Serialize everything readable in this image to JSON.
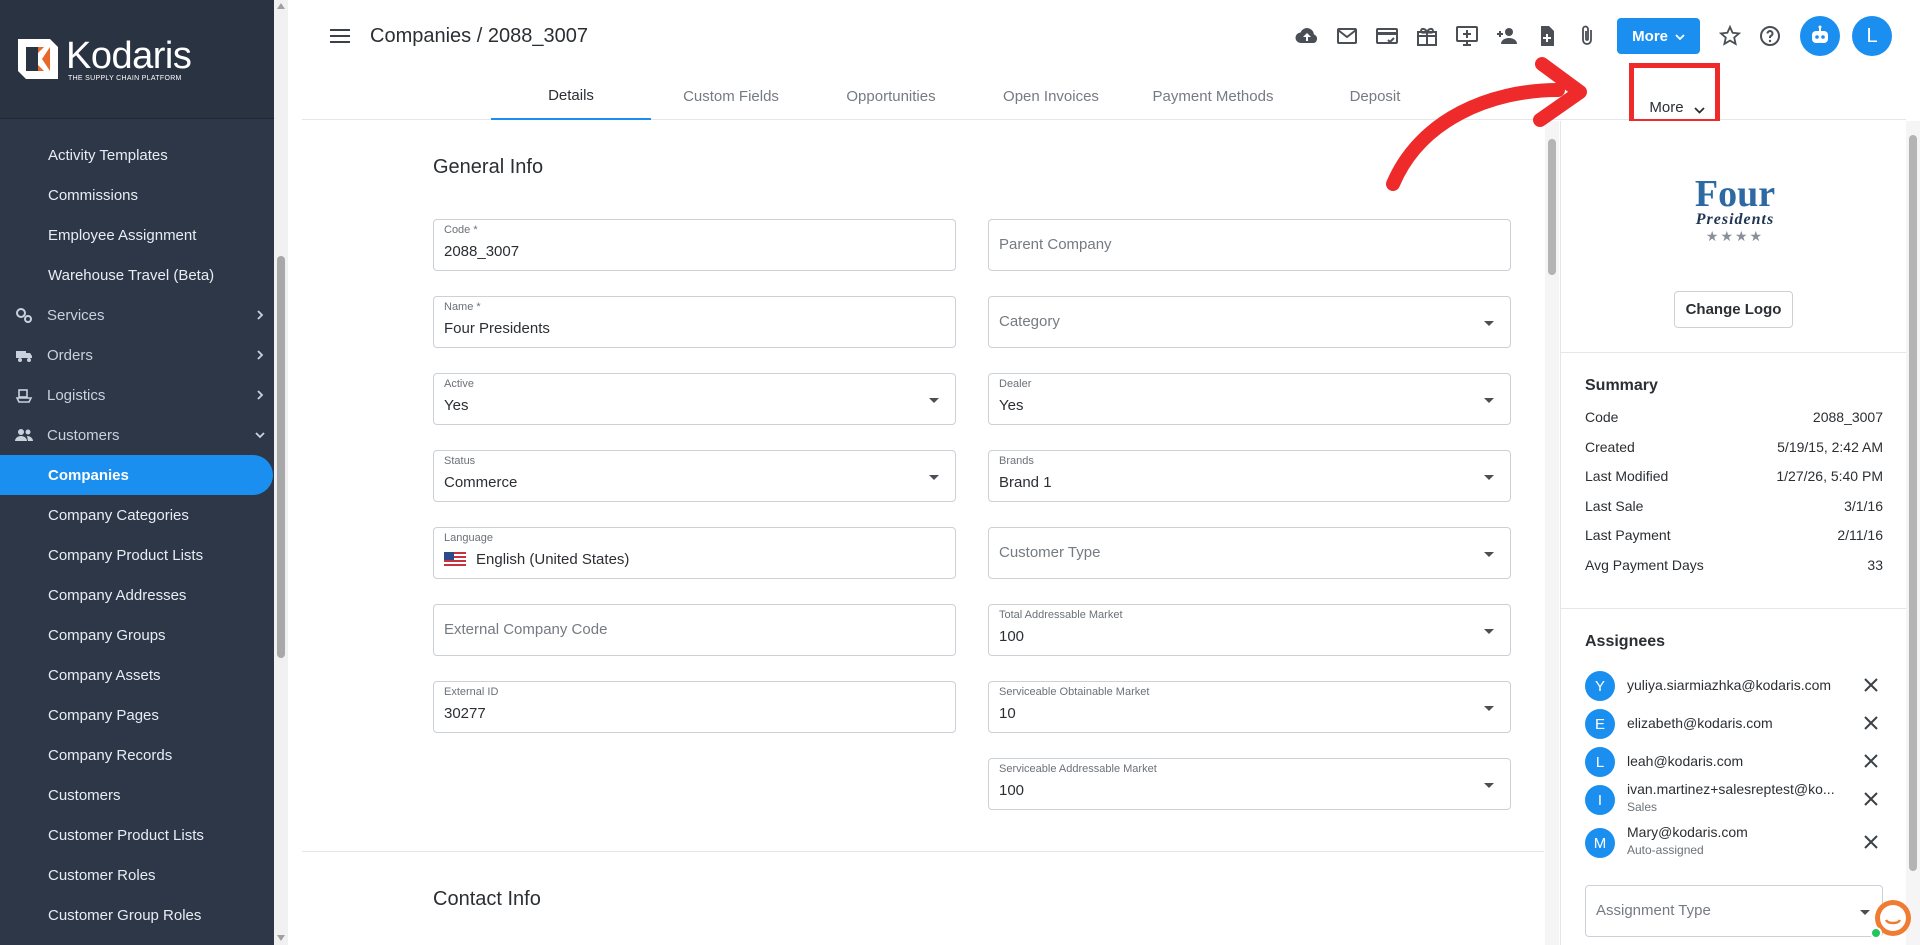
{
  "brand": {
    "name": "Kodaris",
    "tagline": "THE SUPPLY CHAIN PLATFORM"
  },
  "sidebar": {
    "items": [
      {
        "label": "Activity Templates",
        "type": "item"
      },
      {
        "label": "Commissions",
        "type": "item"
      },
      {
        "label": "Employee Assignment",
        "type": "item"
      },
      {
        "label": "Warehouse Travel (Beta)",
        "type": "item"
      },
      {
        "label": "Services",
        "type": "group",
        "icon": "services-icon",
        "expanded": false
      },
      {
        "label": "Orders",
        "type": "group",
        "icon": "truck-icon",
        "expanded": false
      },
      {
        "label": "Logistics",
        "type": "group",
        "icon": "shipping-icon",
        "expanded": false
      },
      {
        "label": "Customers",
        "type": "group",
        "icon": "people-icon",
        "expanded": true
      },
      {
        "label": "Companies",
        "type": "item",
        "active": true
      },
      {
        "label": "Company Categories",
        "type": "item"
      },
      {
        "label": "Company Product Lists",
        "type": "item"
      },
      {
        "label": "Company Addresses",
        "type": "item"
      },
      {
        "label": "Company Groups",
        "type": "item"
      },
      {
        "label": "Company Assets",
        "type": "item"
      },
      {
        "label": "Company Pages",
        "type": "item"
      },
      {
        "label": "Company Records",
        "type": "item"
      },
      {
        "label": "Customers",
        "type": "item"
      },
      {
        "label": "Customer Product Lists",
        "type": "item"
      },
      {
        "label": "Customer Roles",
        "type": "item"
      },
      {
        "label": "Customer Group Roles",
        "type": "item"
      }
    ]
  },
  "header": {
    "breadcrumb": "Companies / 2088_3007",
    "more_label": "More",
    "avatar_initial": "L",
    "toolbar_icons": [
      "cloud-upload-icon",
      "mail-icon",
      "payment-icon",
      "gift-icon",
      "add-screen-icon",
      "add-person-icon",
      "add-file-icon",
      "attachment-icon"
    ]
  },
  "tabs": {
    "items": [
      "Details",
      "Custom Fields",
      "Opportunities",
      "Open Invoices",
      "Payment Methods",
      "Deposit"
    ],
    "active": "Details",
    "more_label": "More"
  },
  "general_info": {
    "title": "General Info",
    "left": [
      {
        "label": "Code *",
        "value": "2088_3007",
        "dropdown": false
      },
      {
        "label": "Name *",
        "value": "Four Presidents",
        "dropdown": false
      },
      {
        "label": "Active",
        "value": "Yes",
        "dropdown": true
      },
      {
        "label": "Status",
        "value": "Commerce",
        "dropdown": true
      },
      {
        "label": "Language",
        "value": "English (United States)",
        "dropdown": false,
        "flag": "us-flag-icon"
      },
      {
        "placeholder": "External Company Code",
        "dropdown": false
      },
      {
        "label": "External ID",
        "value": "30277",
        "dropdown": false
      }
    ],
    "right": [
      {
        "placeholder": "Parent Company",
        "dropdown": false
      },
      {
        "placeholder": "Category",
        "dropdown": true
      },
      {
        "label": "Dealer",
        "value": "Yes",
        "dropdown": true
      },
      {
        "label": "Brands",
        "value": "Brand 1",
        "dropdown": true
      },
      {
        "placeholder": "Customer Type",
        "dropdown": true
      },
      {
        "label": "Total Addressable Market",
        "value": "100",
        "dropdown": true
      },
      {
        "label": "Serviceable Obtainable Market",
        "value": "10",
        "dropdown": true
      },
      {
        "label": "Serviceable Addressable Market",
        "value": "100",
        "dropdown": true
      }
    ]
  },
  "contact_info": {
    "title": "Contact Info"
  },
  "company_logo": {
    "line1": "Four",
    "line2": "Presidents",
    "stars": "★★★★"
  },
  "right_panel": {
    "change_logo": "Change Logo",
    "summary": {
      "title": "Summary",
      "rows": [
        {
          "label": "Code",
          "value": "2088_3007"
        },
        {
          "label": "Created",
          "value": "5/19/15, 2:42 AM"
        },
        {
          "label": "Last Modified",
          "value": "1/27/26, 5:40 PM"
        },
        {
          "label": "Last Sale",
          "value": "3/1/16"
        },
        {
          "label": "Last Payment",
          "value": "2/11/16"
        },
        {
          "label": "Avg Payment Days",
          "value": "33"
        }
      ]
    },
    "assignees": {
      "title": "Assignees",
      "items": [
        {
          "initial": "Y",
          "email": "yuliya.siarmiazhka@kodaris.com",
          "role": ""
        },
        {
          "initial": "E",
          "email": "elizabeth@kodaris.com",
          "role": ""
        },
        {
          "initial": "L",
          "email": "leah@kodaris.com",
          "role": ""
        },
        {
          "initial": "I",
          "email": "ivan.martinez+salesreptest@ko...",
          "role": "Sales"
        },
        {
          "initial": "M",
          "email": "Mary@kodaris.com",
          "role": "Auto-assigned"
        }
      ],
      "assignment_type_placeholder": "Assignment Type"
    }
  },
  "colors": {
    "accent": "#1a8ff0",
    "sidebar": "#2d3748",
    "annotation": "#ee2a2a"
  }
}
